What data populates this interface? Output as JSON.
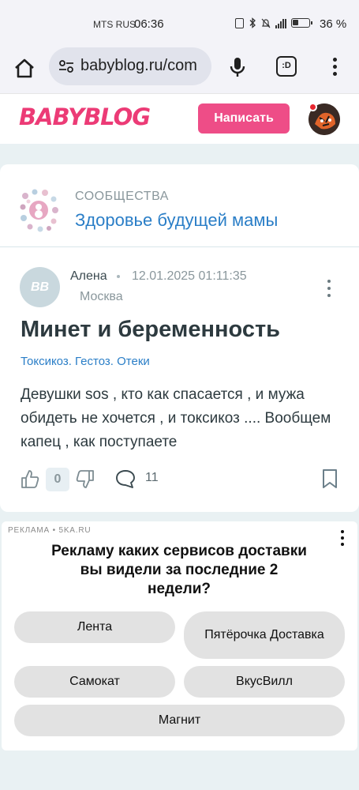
{
  "status_bar": {
    "carrier": "MTS RUS",
    "time": "06:36",
    "battery_percent": "36 %"
  },
  "browser": {
    "url": "babyblog.ru/com",
    "tab_switcher_label": ":D"
  },
  "site_header": {
    "logo_text": "BABYBLOG",
    "write_button": "Написать"
  },
  "community": {
    "label": "СООБЩЕСТВА",
    "name": "Здоровье будущей мамы"
  },
  "post": {
    "avatar_initials": "BB",
    "author": "Алена",
    "date": "12.01.2025 01:11:35",
    "city": "Москва",
    "title": "Минет и беременность",
    "tags": "Токсикоз. Гестоз. Отеки",
    "body": "Девушки sos , кто как спасается , и мужа обидеть не хочется , и токсикоз .... Вообщем капец , как поступаете",
    "likes": "0",
    "comments": "11"
  },
  "ad": {
    "label": "РЕКЛАМА • 5KA.RU",
    "question": "Рекламу каких сервисов доставки вы видели за последние 2 недели?",
    "options": [
      "Лента",
      "Пятёрочка Доставка",
      "Самокат",
      "ВкусВилл",
      "Магнит"
    ]
  },
  "colors": {
    "brand_pink": "#ec3b76",
    "link_blue": "#2a7ec7",
    "page_bg": "#e9f1f3"
  }
}
